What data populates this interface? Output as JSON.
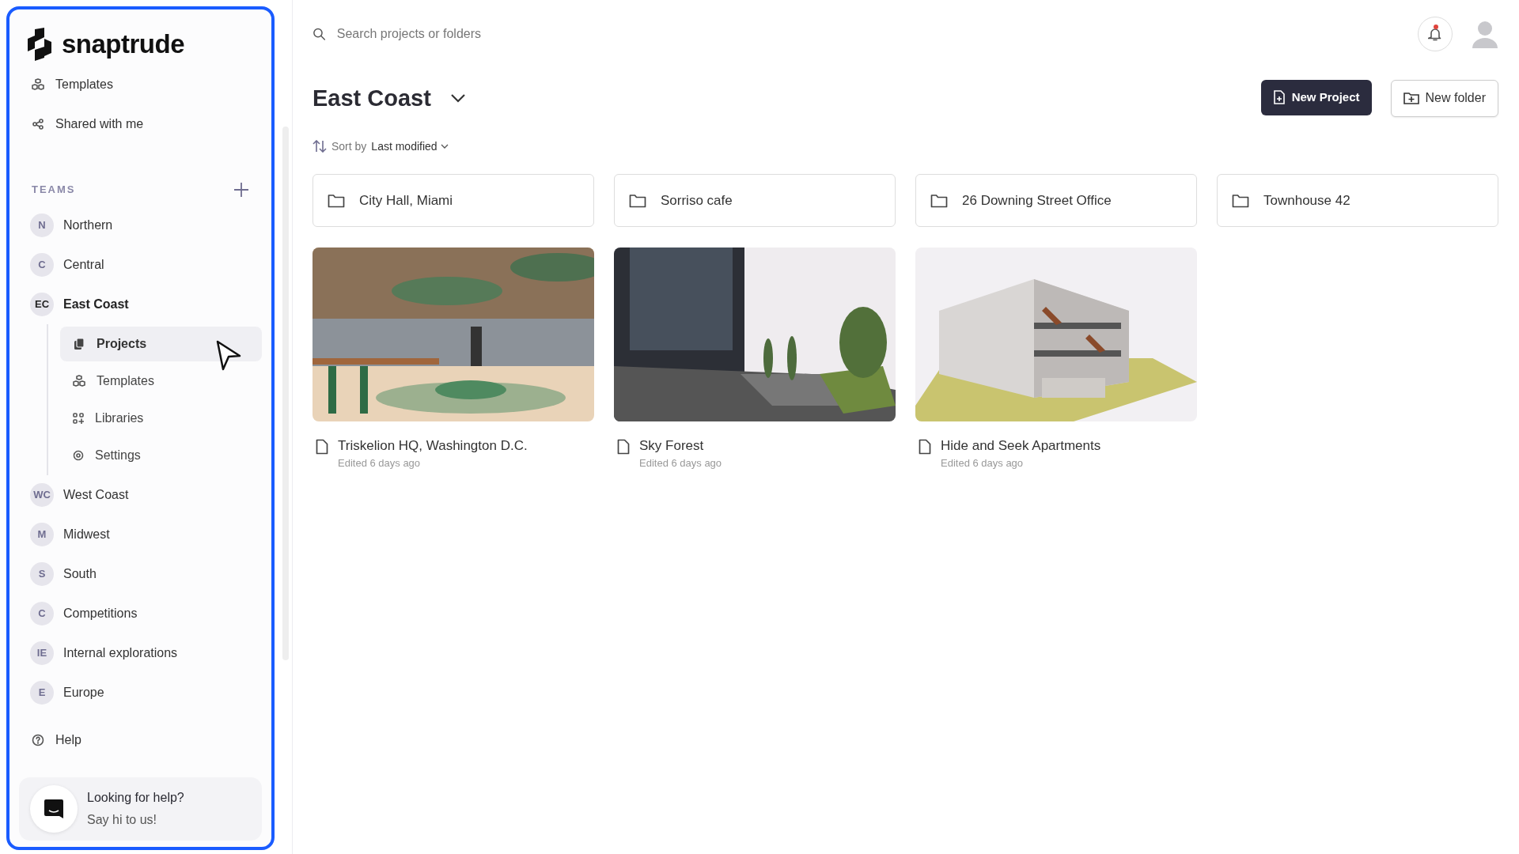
{
  "logo": {
    "text": "snaptrude"
  },
  "nav": [
    {
      "label": "Templates",
      "kind": "templates"
    },
    {
      "label": "Shared with me",
      "kind": "share"
    }
  ],
  "teams": {
    "heading": "TEAMS",
    "items": [
      {
        "initials": "N",
        "name": "Northern",
        "expanded": false
      },
      {
        "initials": "C",
        "name": "Central",
        "expanded": false
      },
      {
        "initials": "EC",
        "name": "East Coast",
        "expanded": true,
        "children": [
          {
            "label": "Projects",
            "kind": "projects",
            "selected": true
          },
          {
            "label": "Templates",
            "kind": "templates",
            "selected": false
          },
          {
            "label": "Libraries",
            "kind": "libraries",
            "selected": false
          },
          {
            "label": "Settings",
            "kind": "settings",
            "selected": false
          }
        ]
      },
      {
        "initials": "WC",
        "name": "West Coast",
        "expanded": false
      },
      {
        "initials": "M",
        "name": "Midwest",
        "expanded": false
      },
      {
        "initials": "S",
        "name": "South",
        "expanded": false
      },
      {
        "initials": "C",
        "name": "Competitions",
        "expanded": false
      },
      {
        "initials": "IE",
        "name": "Internal explorations",
        "expanded": false
      },
      {
        "initials": "E",
        "name": "Europe",
        "expanded": false
      }
    ]
  },
  "help": {
    "label": "Help"
  },
  "chat": {
    "title": "Looking for help?",
    "subtitle": "Say hi to us!"
  },
  "search": {
    "placeholder": "Search projects or folders"
  },
  "notifications": {
    "unread": true
  },
  "header": {
    "title": "East Coast"
  },
  "buttons": [
    {
      "label": "New Project",
      "kind": "primary"
    },
    {
      "label": "New folder",
      "kind": "secondary"
    }
  ],
  "sort": {
    "label": "Sort by",
    "value": "Last modified"
  },
  "folders": [
    {
      "name": "City Hall, Miami"
    },
    {
      "name": "Sorriso cafe"
    },
    {
      "name": "26 Downing Street Office"
    },
    {
      "name": "Townhouse 42"
    }
  ],
  "projects": [
    {
      "name": "Triskelion HQ, Washington D.C.",
      "edited": "Edited 6 days ago",
      "kind": "picture"
    },
    {
      "name": "Sky Forest",
      "edited": "Edited 6 days ago",
      "kind": "picture"
    },
    {
      "name": "Hide and Seek Apartments",
      "edited": "Edited 6 days ago",
      "kind": "picture"
    }
  ]
}
